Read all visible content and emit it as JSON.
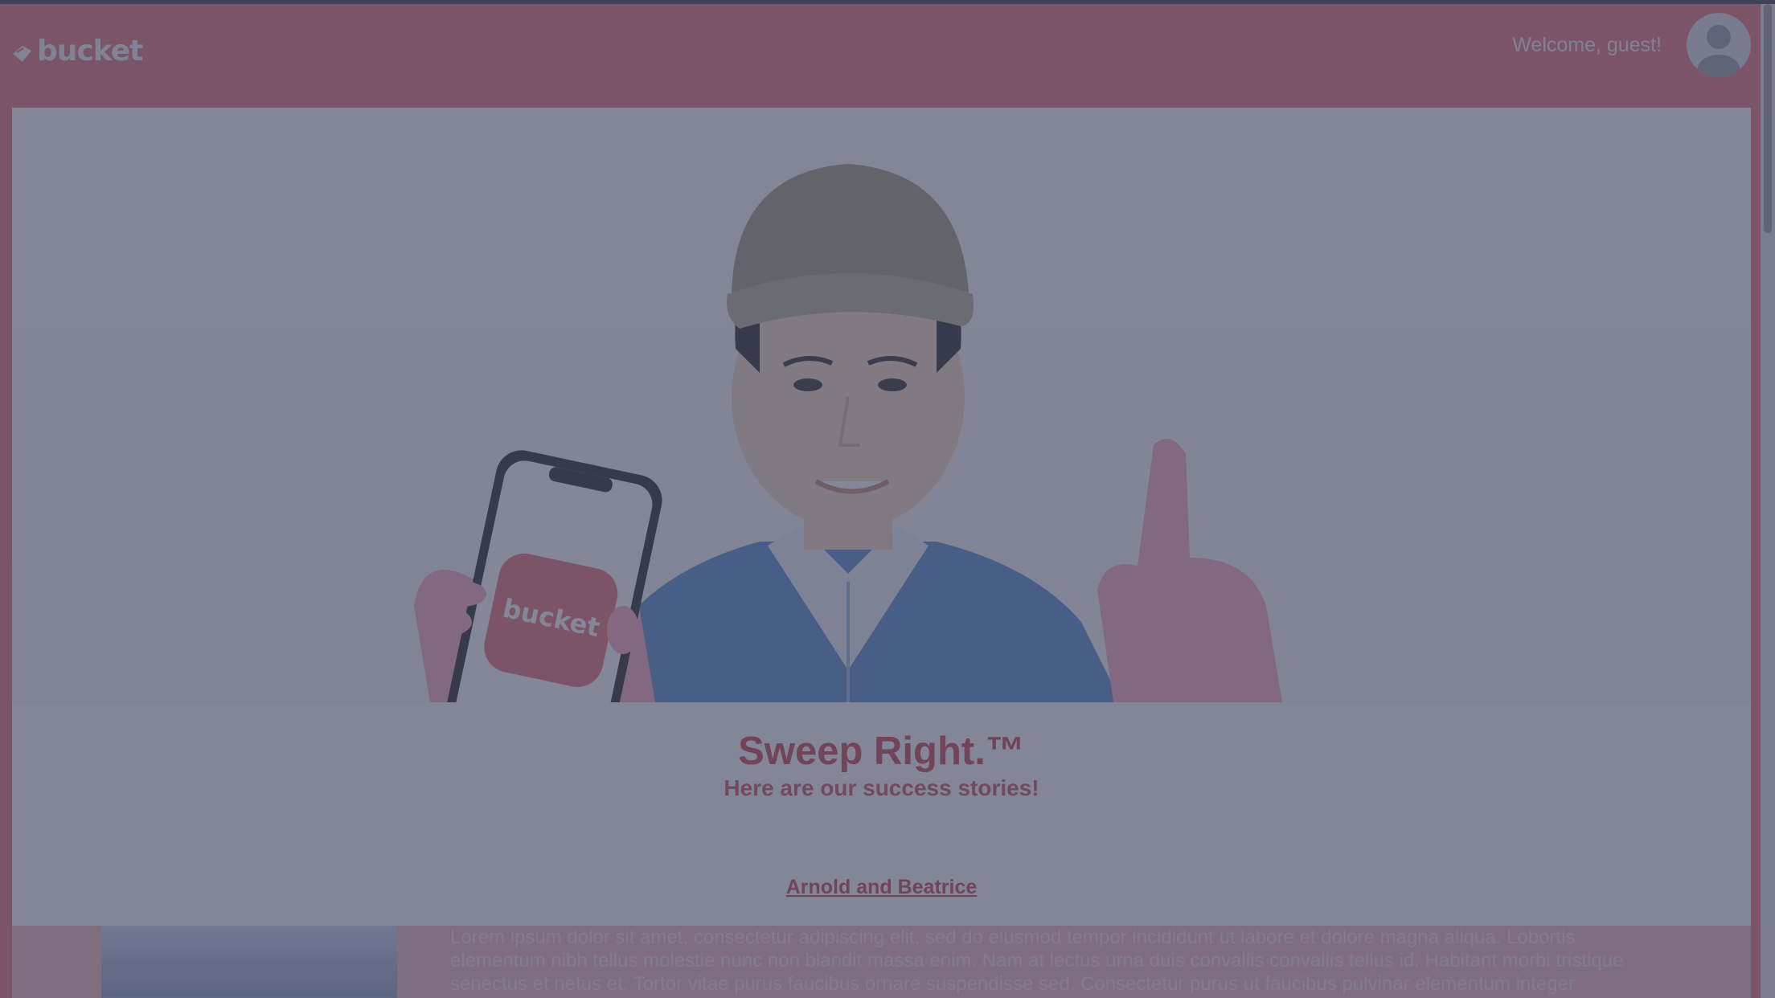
{
  "header": {
    "logo_text": "bucket",
    "welcome_text": "Welcome, guest!"
  },
  "hero": {
    "phone_logo_text": "bucket"
  },
  "banner": {
    "title": "Sweep Right.™",
    "subtitle": "Here are our success stories!"
  },
  "story": {
    "name": "Arnold and Beatrice",
    "text": "Lorem ipsum dolor sit amet, consectetur adipiscing elit, sed do eiusmod tempor incididunt ut labore et dolore magna aliqua. Lobortis elementum nibh tellus molestie nunc non blandit massa enim. Nam at lectus urna duis convallis convallis tellus id. Habitant morbi tristique senectus et netus et. Tortor vitae purus faucibus ornare suspendisse sed. Consectetur purus ut faucibus pulvinar elementum integer"
  },
  "colors": {
    "brand": "#e8737b",
    "title": "#c94650",
    "overlay": "#3e445c"
  },
  "icons": {
    "logo": "bucket-logo-icon",
    "avatar": "user-avatar-icon"
  }
}
